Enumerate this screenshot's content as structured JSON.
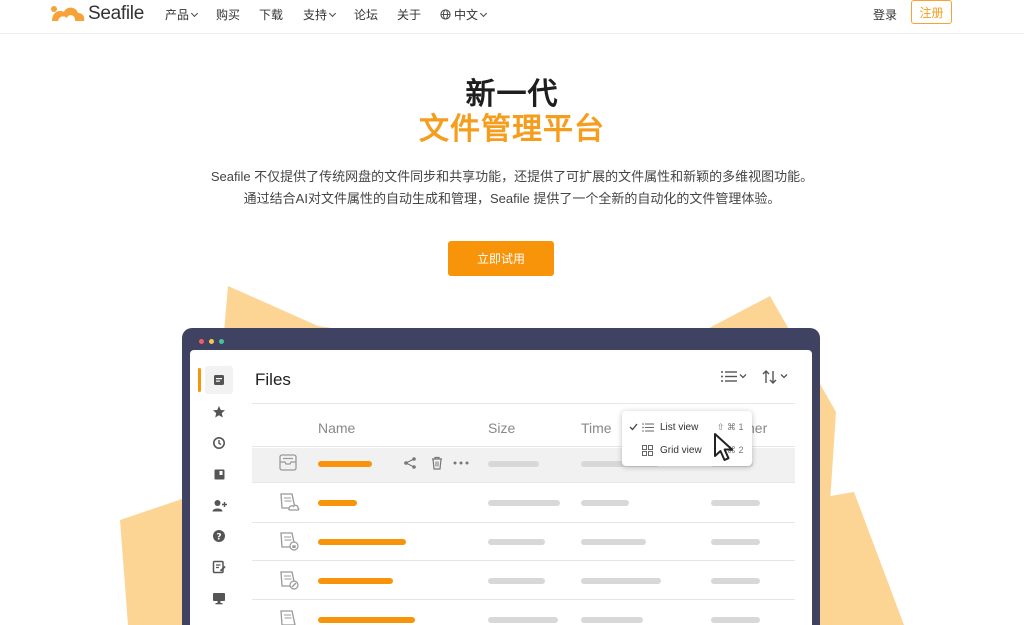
{
  "nav": {
    "logo_text": "Seafile",
    "items": [
      {
        "label": "产品",
        "dropdown": true
      },
      {
        "label": "购买",
        "dropdown": false
      },
      {
        "label": "下载",
        "dropdown": false
      },
      {
        "label": "支持",
        "dropdown": true
      },
      {
        "label": "论坛",
        "dropdown": false
      },
      {
        "label": "关于",
        "dropdown": false
      },
      {
        "label": "中文",
        "dropdown": true,
        "icon": "globe-icon"
      }
    ],
    "login": "登录",
    "register": "注册"
  },
  "hero": {
    "title_line1": "新一代",
    "title_line2": "文件管理平台",
    "desc_line1": "Seafile 不仅提供了传统网盘的文件同步和共享功能，还提供了可扩展的文件属性和新颖的多维视图功能。",
    "desc_line2": "通过结合AI对文件属性的自动生成和管理，Seafile 提供了一个全新的自动化的文件管理体验。",
    "cta": "立即试用"
  },
  "app": {
    "title": "Files",
    "columns": [
      "Name",
      "Size",
      "Time",
      "Owner"
    ],
    "columns_visible": [
      "Name",
      "Size",
      "Time",
      "ner"
    ],
    "view_menu": {
      "items": [
        {
          "label": "List view",
          "shortcut": "⇧ ⌘ 1",
          "checked": true
        },
        {
          "label": "Grid view",
          "shortcut": "⇧ ⌘ 2",
          "checked": false
        }
      ]
    },
    "sidebar_icons": [
      "files-icon",
      "star-icon",
      "history-icon",
      "library-icon",
      "add-user-icon",
      "help-icon",
      "edit-note-icon",
      "monitor-icon"
    ]
  },
  "colors": {
    "accent": "#f7940a",
    "window_frame": "#3f4260",
    "deco_shape": "#fcd595",
    "dot_red": "#f45b69",
    "dot_yellow": "#f9c74f",
    "dot_green": "#43c59e"
  }
}
